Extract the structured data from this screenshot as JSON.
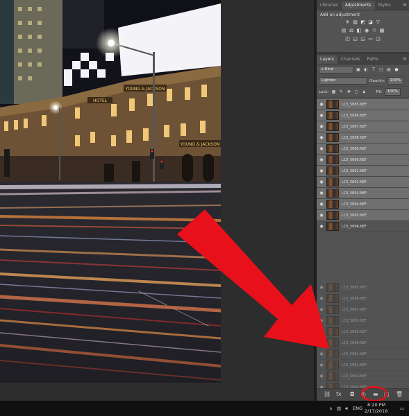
{
  "adjustments_panel": {
    "tabs": [
      "Libraries",
      "Adjustments",
      "Styles"
    ],
    "active_tab": "Adjustments",
    "heading": "Add an adjustment"
  },
  "layers_panel": {
    "tabs": [
      "Layers",
      "Channels",
      "Paths"
    ],
    "active_tab": "Layers",
    "filter_kind": "Kind",
    "blend_mode": "Lighten",
    "opacity_label": "Opacity:",
    "opacity_value": "100%",
    "lock_label": "Lock:",
    "fill_label": "Fill:",
    "fill_value": "100%",
    "layers": [
      {
        "name": "LC3_5885.NEF",
        "selected": true
      },
      {
        "name": "LC3_5886.NEF",
        "selected": true
      },
      {
        "name": "LC3_5887.NEF",
        "selected": true
      },
      {
        "name": "LC3_5888.NEF",
        "selected": true
      },
      {
        "name": "LC3_5889.NEF",
        "selected": true
      },
      {
        "name": "LC3_5890.NEF",
        "selected": true
      },
      {
        "name": "LC3_5891.NEF",
        "selected": true
      },
      {
        "name": "LC3_5892.NEF",
        "selected": true
      },
      {
        "name": "LC3_5893.NEF",
        "selected": true
      },
      {
        "name": "LC3_5894.NEF",
        "selected": true
      },
      {
        "name": "LC3_5895.NEF",
        "selected": true
      },
      {
        "name": "LC3_5896.NEF",
        "selected": false
      }
    ],
    "drag_ghost_layers": [
      "LC3_5885.NEF",
      "LC3_5886.NEF",
      "LC3_5887.NEF",
      "LC3_5888.NEF",
      "LC3_5889.NEF",
      "LC3_5890.NEF",
      "LC3_5891.NEF",
      "LC3_5892.NEF",
      "LC3_5893.NEF",
      "LC3_5894.NEF",
      "LC3_5895.NEF"
    ]
  },
  "canvas": {
    "signs": [
      "YOUNG & JACKSON",
      "HOTEL",
      "YOUNG & JACKSON"
    ]
  },
  "taskbar": {
    "language": "ENG",
    "time": "8:20 PM",
    "date": "2/17/2016"
  },
  "annotation": {
    "arrow_color": "#e8101a",
    "circle_color": "#e8101a"
  }
}
